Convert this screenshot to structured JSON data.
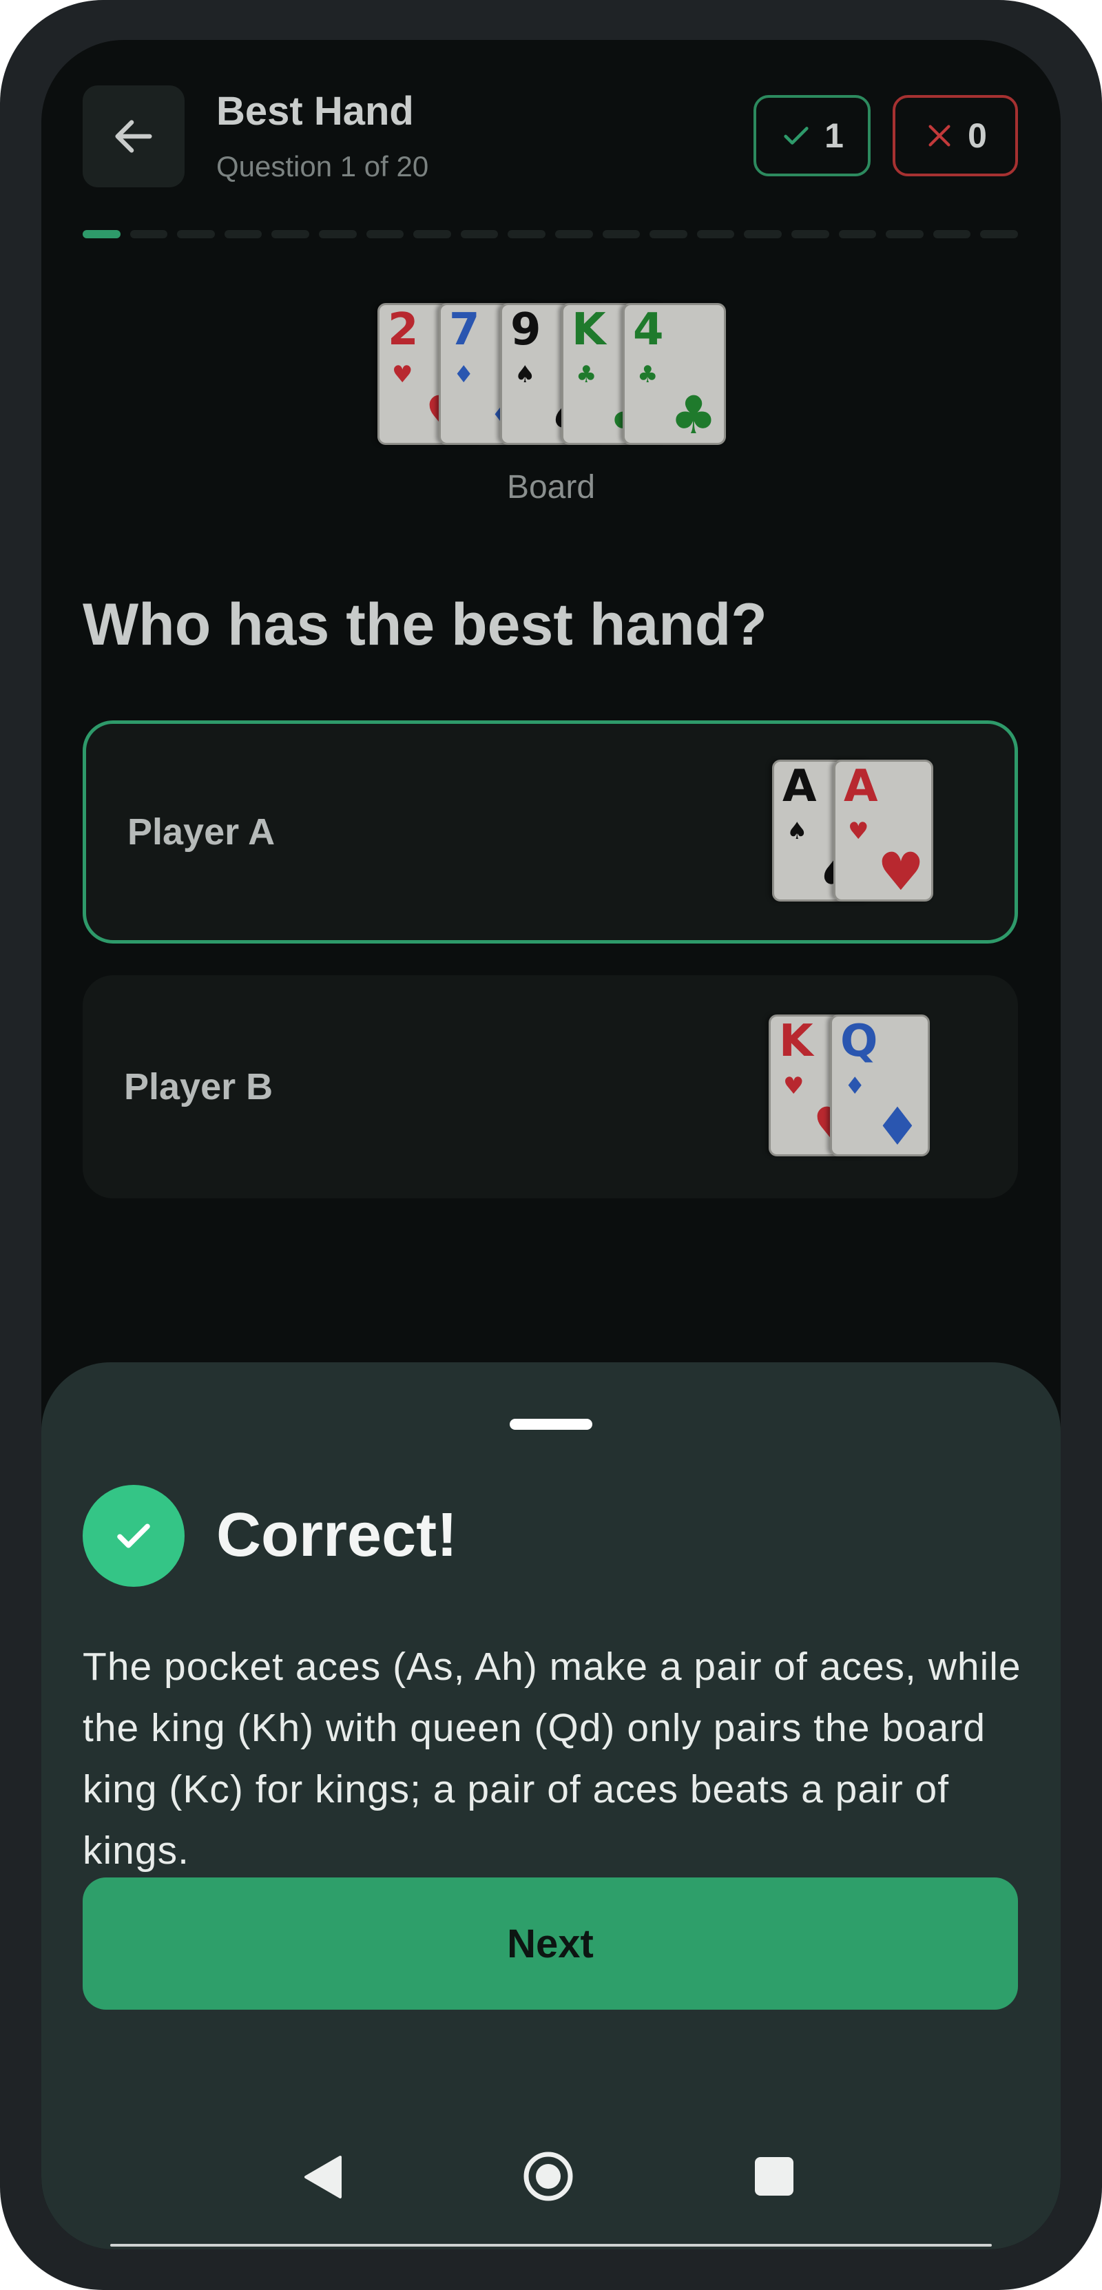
{
  "header": {
    "title": "Best Hand",
    "subtitle": "Question 1 of 20",
    "correct_count": "1",
    "wrong_count": "0"
  },
  "progress": {
    "current": 1,
    "total": 20
  },
  "board": {
    "label": "Board",
    "cards": [
      {
        "rank": "2",
        "suit": "♥",
        "color": "red"
      },
      {
        "rank": "7",
        "suit": "♦",
        "color": "blue"
      },
      {
        "rank": "9",
        "suit": "♠",
        "color": "black"
      },
      {
        "rank": "K",
        "suit": "♣",
        "color": "green"
      },
      {
        "rank": "4",
        "suit": "♣",
        "color": "green"
      }
    ]
  },
  "question": "Who has the best hand?",
  "options": [
    {
      "label": "Player A",
      "selected": true,
      "cards": [
        {
          "rank": "A",
          "suit": "♠",
          "color": "black"
        },
        {
          "rank": "A",
          "suit": "♥",
          "color": "red"
        }
      ]
    },
    {
      "label": "Player B",
      "selected": false,
      "cards": [
        {
          "rank": "K",
          "suit": "♥",
          "color": "red"
        },
        {
          "rank": "Q",
          "suit": "♦",
          "color": "blue"
        }
      ]
    }
  ],
  "feedback": {
    "title": "Correct!",
    "explanation": "The pocket aces (As, Ah) make a pair of aces, while the king (Kh) with queen (Qd) only pairs the board king (Kc) for kings; a pair of aces beats a pair of kings.",
    "next_label": "Next"
  },
  "colors": {
    "accent": "#2e9f6a",
    "success": "#34c586",
    "error": "#a63131",
    "sheet": "#243130"
  }
}
